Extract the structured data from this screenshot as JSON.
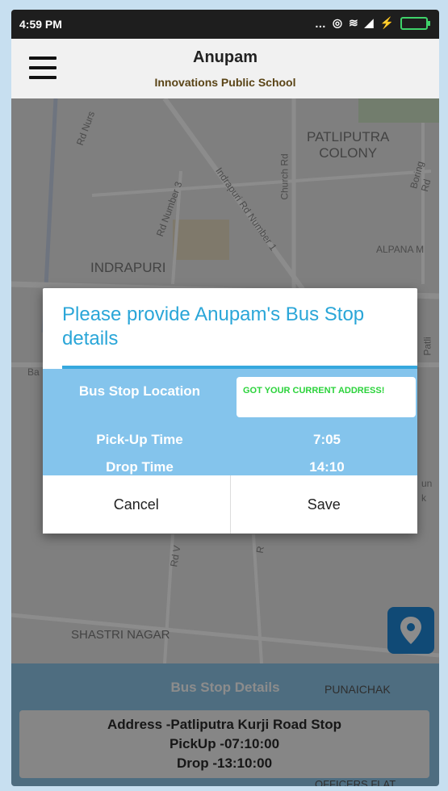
{
  "status_bar": {
    "time": "4:59 PM",
    "icons": [
      "more-dots",
      "alarm-icon",
      "wifi-icon",
      "signal-icon",
      "bolt-icon",
      "battery-icon"
    ]
  },
  "app_bar": {
    "title": "Anupam",
    "subtitle": "Innovations Public School"
  },
  "map": {
    "labels": {
      "patliputra": "PATLIPUTRA\nCOLONY",
      "indrapuri": "INDRAPURI",
      "alpana": "ALPANA M",
      "shastri": "SHASTRI NAGAR",
      "punaichak": "PUNAICHAK",
      "rd_nurs": "Rd Nurs",
      "rd_number3": "Rd Number 3",
      "indrapuri_rd": "Indrapuri Rd Number 1",
      "church_rd": "Church Rd",
      "boring_rd": "Boring Rd",
      "ba": "Ba",
      "patli": "Patli",
      "un": "un",
      "k": "k",
      "rd_v": "Rd V",
      "ro": "R",
      "officers_flat": "OFFICERS FLAT"
    }
  },
  "dialog": {
    "title": "Please provide Anupam's Bus Stop details",
    "rows": [
      {
        "label": "Bus Stop Location",
        "value": "GOT YOUR CURRENT ADDRESS!"
      },
      {
        "label": "Pick-Up Time",
        "value": "7:05"
      },
      {
        "label": "Drop Time",
        "value": "14:10"
      }
    ],
    "cancel_label": "Cancel",
    "save_label": "Save"
  },
  "bottom_panel": {
    "title": "Bus Stop Details",
    "address": "Address -Patliputra Kurji Road Stop",
    "pickup": "PickUp -07:10:00",
    "drop": "Drop -13:10:00"
  },
  "colors": {
    "accent": "#2aa6d8",
    "panel": "#84c4ec",
    "locate": "#1e88d8",
    "address_text": "#2bd33b"
  }
}
